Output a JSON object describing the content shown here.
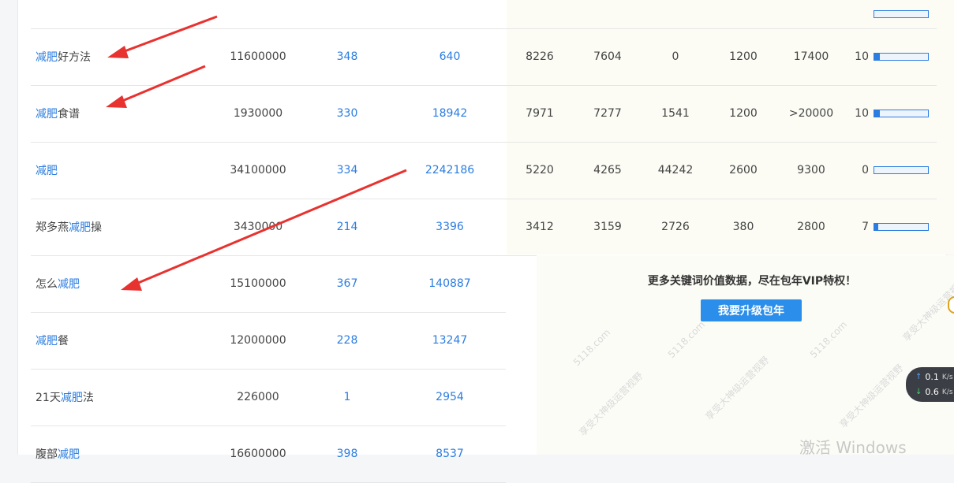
{
  "rows": [
    {
      "kw_pre": "",
      "kw_hl": "减肥",
      "kw_post": "好方法",
      "index": "11600000",
      "a": "348",
      "b": "640",
      "c": "8226",
      "d": "7604",
      "e": "0",
      "f": "1200",
      "g": "17400",
      "h": "10",
      "h_level": 0.1
    },
    {
      "kw_pre": "",
      "kw_hl": "减肥",
      "kw_post": "食谱",
      "index": "1930000",
      "a": "330",
      "b": "18942",
      "c": "7971",
      "d": "7277",
      "e": "1541",
      "f": "1200",
      "g": ">20000",
      "h": "10",
      "h_level": 0.1
    },
    {
      "kw_pre": "",
      "kw_hl": "减肥",
      "kw_post": "",
      "index": "34100000",
      "a": "334",
      "b": "2242186",
      "c": "5220",
      "d": "4265",
      "e": "44242",
      "f": "2600",
      "g": "9300",
      "h": "0",
      "h_level": 0
    },
    {
      "kw_pre": "郑多燕",
      "kw_hl": "减肥",
      "kw_post": "操",
      "index": "3430000",
      "a": "214",
      "b": "3396",
      "c": "3412",
      "d": "3159",
      "e": "2726",
      "f": "380",
      "g": "2800",
      "h": "7",
      "h_level": 0.07
    },
    {
      "kw_pre": "怎么",
      "kw_hl": "减肥",
      "kw_post": "",
      "index": "15100000",
      "a": "367",
      "b": "140887"
    },
    {
      "kw_pre": "",
      "kw_hl": "减肥",
      "kw_post": "餐",
      "index": "12000000",
      "a": "228",
      "b": "13247"
    },
    {
      "kw_pre": "21天",
      "kw_hl": "减肥",
      "kw_post": "法",
      "index": "226000",
      "a": "1",
      "b": "2954"
    },
    {
      "kw_pre": "腹部",
      "kw_hl": "减肥",
      "kw_post": "",
      "index": "16600000",
      "a": "398",
      "b": "8537"
    }
  ],
  "vip": {
    "text": "更多关键词价值数据，尽在包年VIP特权！",
    "button": "我要升级包年"
  },
  "watermark": {
    "a": "5118.com",
    "b": "享受大神级运营视野"
  },
  "speed": {
    "up": "0.1",
    "down": "0.6",
    "unit": "K/s"
  },
  "windows_notice": "激活 Windows",
  "colors": {
    "link": "#2b7de1",
    "button": "#2b8eea",
    "arrow": "#e8322f"
  }
}
